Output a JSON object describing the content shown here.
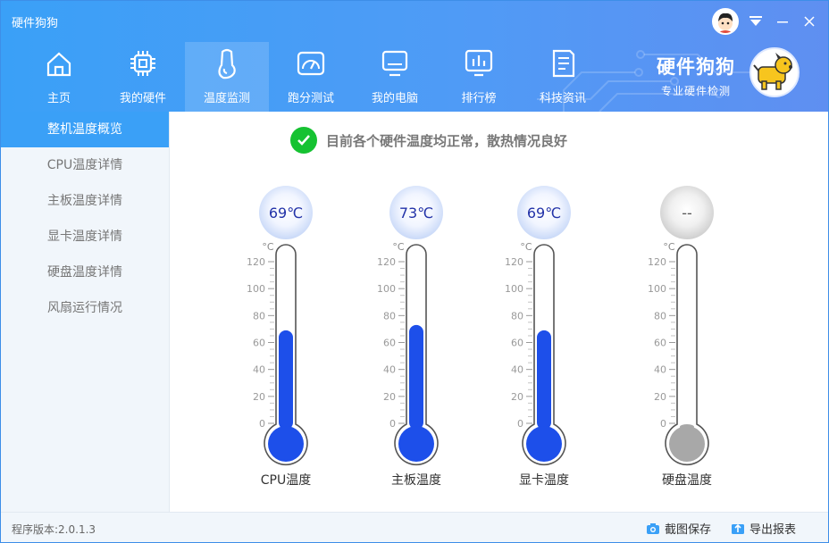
{
  "app_title": "硬件狗狗",
  "nav": [
    {
      "label": "主页",
      "icon": "home-icon"
    },
    {
      "label": "我的硬件",
      "icon": "chip-icon"
    },
    {
      "label": "温度监测",
      "icon": "thermometer-icon",
      "active": true
    },
    {
      "label": "跑分测试",
      "icon": "speedometer-icon"
    },
    {
      "label": "我的电脑",
      "icon": "monitor-icon"
    },
    {
      "label": "排行榜",
      "icon": "ranking-icon"
    },
    {
      "label": "科技资讯",
      "icon": "news-icon"
    }
  ],
  "brand": {
    "name": "硬件狗狗",
    "slogan": "专业硬件检测"
  },
  "sidebar": [
    {
      "label": "整机温度概览",
      "active": true
    },
    {
      "label": "CPU温度详情"
    },
    {
      "label": "主板温度详情"
    },
    {
      "label": "显卡温度详情"
    },
    {
      "label": "硬盘温度详情"
    },
    {
      "label": "风扇运行情况"
    }
  ],
  "status_message": "目前各个硬件温度均正常，散热情况良好",
  "thermometer_unit": "°C",
  "scale_ticks": [
    "120",
    "100",
    "80",
    "60",
    "40",
    "20",
    "0"
  ],
  "scale_max": 120,
  "thermometers": [
    {
      "label": "CPU温度",
      "reading": "69℃",
      "value": 69,
      "color": "#1d4fea"
    },
    {
      "label": "主板温度",
      "reading": "73℃",
      "value": 73,
      "color": "#1d4fea"
    },
    {
      "label": "显卡温度",
      "reading": "69℃",
      "value": 69,
      "color": "#1d4fea"
    },
    {
      "label": "硬盘温度",
      "reading": "--",
      "value": null,
      "color": "#a8a8a8"
    }
  ],
  "colors": {
    "accent": "#3aa0f7",
    "mercury": "#1d4fea",
    "ok_green": "#16c232",
    "inactive": "#a8a8a8"
  },
  "footer": {
    "version": "程序版本:2.0.1.3",
    "screenshot_label": "截图保存",
    "export_label": "导出报表"
  }
}
